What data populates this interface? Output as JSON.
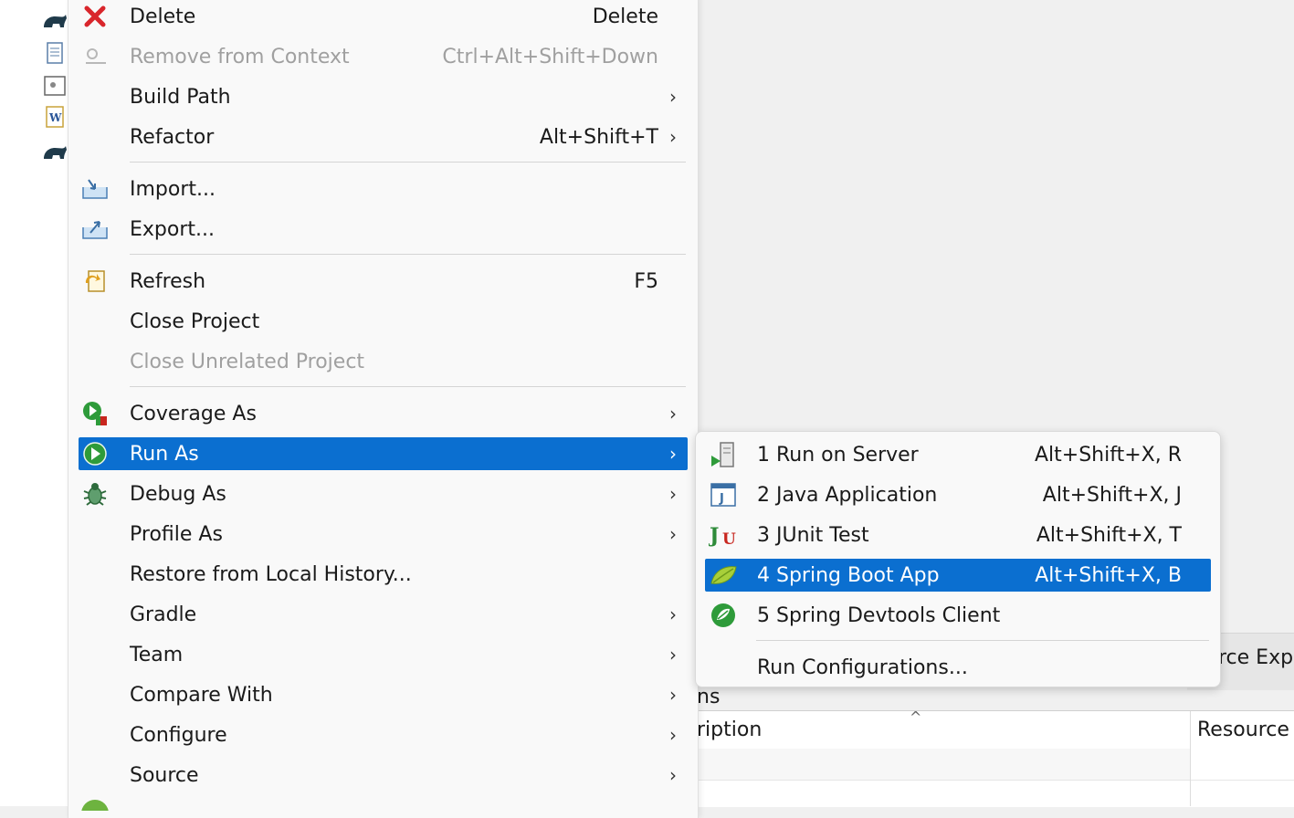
{
  "main_menu": {
    "items": [
      {
        "label": "Delete",
        "shortcut": "Delete",
        "icon": "delete-icon"
      },
      {
        "label": "Remove from Context",
        "shortcut": "Ctrl+Alt+Shift+Down",
        "icon": "remove-context-icon",
        "disabled": true
      },
      {
        "label": "Build Path",
        "submenu": true
      },
      {
        "label": "Refactor",
        "shortcut": "Alt+Shift+T",
        "submenu": true
      },
      {
        "label": "Import...",
        "icon": "import-icon"
      },
      {
        "label": "Export...",
        "icon": "export-icon"
      },
      {
        "label": "Refresh",
        "shortcut": "F5",
        "icon": "refresh-icon"
      },
      {
        "label": "Close Project"
      },
      {
        "label": "Close Unrelated Project",
        "disabled": true
      },
      {
        "label": "Coverage As",
        "submenu": true,
        "icon": "coverage-icon"
      },
      {
        "label": "Run As",
        "submenu": true,
        "icon": "run-icon",
        "active": true
      },
      {
        "label": "Debug As",
        "submenu": true,
        "icon": "debug-bug-icon"
      },
      {
        "label": "Profile As",
        "submenu": true
      },
      {
        "label": "Restore from Local History..."
      },
      {
        "label": "Gradle",
        "submenu": true
      },
      {
        "label": "Team",
        "submenu": true
      },
      {
        "label": "Compare With",
        "submenu": true
      },
      {
        "label": "Configure",
        "submenu": true
      },
      {
        "label": "Source",
        "submenu": true
      }
    ],
    "arrow": "›"
  },
  "run_as_submenu": {
    "items": [
      {
        "label": "1 Run on Server",
        "shortcut": "Alt+Shift+X, R",
        "icon": "server-icon"
      },
      {
        "label": "2 Java Application",
        "shortcut": "Alt+Shift+X, J",
        "icon": "java-app-icon"
      },
      {
        "label": "3 JUnit Test",
        "shortcut": "Alt+Shift+X, T",
        "icon": "junit-icon"
      },
      {
        "label": "4 Spring Boot App",
        "shortcut": "Alt+Shift+X, B",
        "icon": "spring-leaf-icon",
        "active": true
      },
      {
        "label": "5 Spring Devtools Client",
        "icon": "devtools-icon"
      },
      {
        "label": "Run Configurations..."
      }
    ]
  },
  "background": {
    "tab_label": "rce Expl",
    "view_title": "ns",
    "column_description": "ription",
    "column_resource": "Resource",
    "sort_indicator": "^"
  },
  "colors": {
    "selection": "#0b6fd0",
    "menu_bg": "#f9f9f9",
    "disabled_text": "#a0a0a0"
  }
}
